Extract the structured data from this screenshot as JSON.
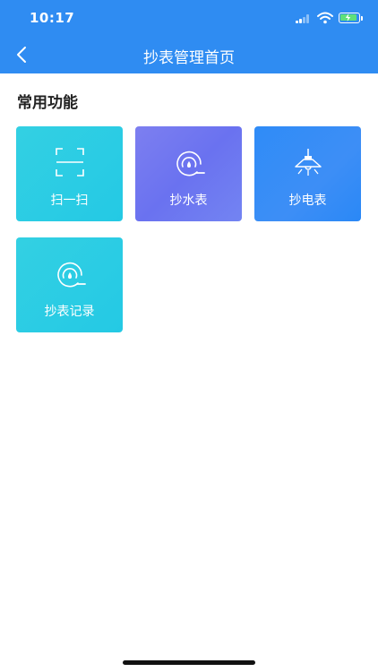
{
  "status_bar": {
    "time": "10:17"
  },
  "nav": {
    "title": "抄表管理首页",
    "back_icon": "chevron-left-icon"
  },
  "section": {
    "title": "常用功能"
  },
  "tiles": [
    {
      "label": "扫一扫",
      "icon": "scan-icon",
      "color": "#27cbe4"
    },
    {
      "label": "抄水表",
      "icon": "water-meter-icon",
      "color": "#6e76f0"
    },
    {
      "label": "抄电表",
      "icon": "electric-meter-icon",
      "color": "#2e8bf6"
    },
    {
      "label": "抄表记录",
      "icon": "meter-record-icon",
      "color": "#27cbe4"
    }
  ],
  "colors": {
    "header": "#2f8cf2",
    "background": "#ffffff",
    "title_text": "#222222"
  }
}
